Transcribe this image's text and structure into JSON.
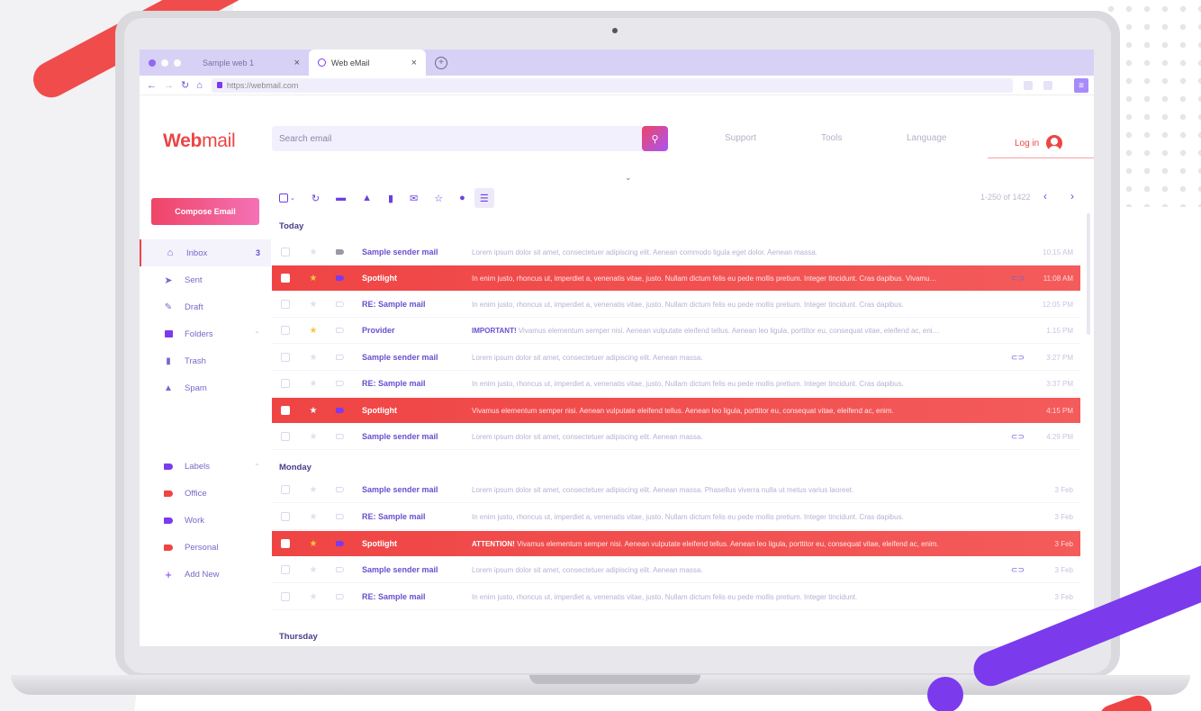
{
  "browser": {
    "tabs": [
      {
        "label": "Sample web 1",
        "active": false
      },
      {
        "label": "Web eMail",
        "active": true
      }
    ],
    "url": "https://webmail.com"
  },
  "app": {
    "logo_bold": "Web",
    "logo_light": "mail",
    "search_placeholder": "Search email",
    "nav": [
      "Support",
      "Tools",
      "Language"
    ],
    "login_label": "Log in"
  },
  "sidebar": {
    "compose_label": "Compose Email",
    "items": [
      {
        "label": "Inbox",
        "count": "3",
        "icon": "inbox-icon"
      },
      {
        "label": "Sent",
        "icon": "send-icon"
      },
      {
        "label": "Draft",
        "icon": "pencil-icon"
      },
      {
        "label": "Folders",
        "icon": "folder-icon"
      },
      {
        "label": "Trash",
        "icon": "trash-icon"
      },
      {
        "label": "Spam",
        "icon": "spam-icon"
      }
    ],
    "labels_title": "Labels",
    "labels": [
      {
        "label": "Office",
        "color": "#ef4444"
      },
      {
        "label": "Work",
        "color": "#7c3aed"
      },
      {
        "label": "Personal",
        "color": "#ef4444"
      }
    ],
    "add_new": "Add New"
  },
  "toolbar": {
    "pager": "1-250 of 1422"
  },
  "sections": {
    "today": "Today",
    "monday": "Monday",
    "thursday": "Thursday"
  },
  "emails": [
    {
      "sender": "Sample sender mail",
      "lead": "",
      "preview": "Lorem ipsum dolor sit amet, consectetuer adipiscing elit. Aenean commodo ligula eget dolor. Aenean massa.",
      "time": "10:15 AM",
      "starred": false,
      "highlight": false,
      "tag": "gray",
      "attachment": false
    },
    {
      "sender": "Spotlight",
      "lead": "",
      "preview": "In enim justo, rhoncus ut, imperdiet a, venenatis vitae, justo. Nullam dictum felis eu pede mollis pretium. Integer tincidunt. Cras dapibus. Vivamus elementum.",
      "time": "11:08 AM",
      "starred": true,
      "highlight": true,
      "tag": "purple",
      "attachment": true
    },
    {
      "sender": "RE: Sample mail",
      "lead": "",
      "preview": "In enim justo, rhoncus ut, imperdiet a, venenatis vitae, justo. Nullam dictum felis eu pede mollis pretium. Integer tincidunt. Cras dapibus.",
      "time": "12:05 PM",
      "starred": false,
      "highlight": false,
      "tag": "outline",
      "attachment": false
    },
    {
      "sender": "Provider",
      "lead": "IMPORTANT!",
      "preview": "Vivamus elementum semper nisi. Aenean vulputate eleifend tellus. Aenean leo ligula, porttitor eu, consequat vitae, eleifend ac, enim.",
      "time": "1:15 PM",
      "starred": true,
      "highlight": false,
      "tag": "outline",
      "attachment": false
    },
    {
      "sender": "Sample sender mail",
      "lead": "",
      "preview": "Lorem ipsum dolor sit amet, consectetuer adipiscing elit. Aenean massa.",
      "time": "3:27 PM",
      "starred": false,
      "highlight": false,
      "tag": "outline",
      "attachment": true
    },
    {
      "sender": "RE: Sample mail",
      "lead": "",
      "preview": "In enim justo, rhoncus ut, imperdiet a, venenatis vitae, justo. Nullam dictum felis eu pede mollis pretium. Integer tincidunt. Cras dapibus.",
      "time": "3:37 PM",
      "starred": false,
      "highlight": false,
      "tag": "outline",
      "attachment": false
    },
    {
      "sender": "Spotlight",
      "lead": "",
      "preview": "Vivamus elementum semper nisi. Aenean vulputate eleifend tellus. Aenean leo ligula, porttitor eu, consequat vitae, eleifend ac, enim.",
      "time": "4:15 PM",
      "starred": true,
      "highlight": true,
      "tag": "purple",
      "attachment": false
    },
    {
      "sender": "Sample sender mail",
      "lead": "",
      "preview": "Lorem ipsum dolor sit amet, consectetuer adipiscing elit. Aenean massa.",
      "time": "4:29 PM",
      "starred": false,
      "highlight": false,
      "tag": "outline",
      "attachment": true
    },
    {
      "sender": "Sample sender mail",
      "lead": "",
      "preview": "Lorem ipsum dolor sit amet, consectetuer adipiscing elit. Aenean massa. Phasellus viverra nulla ut metus varius laoreet.",
      "time": "3 Feb",
      "starred": false,
      "highlight": false,
      "tag": "outline",
      "attachment": false
    },
    {
      "sender": "RE: Sample mail",
      "lead": "",
      "preview": "In enim justo, rhoncus ut, imperdiet a, venenatis vitae, justo. Nullam dictum felis eu pede mollis pretium. Integer tincidunt. Cras dapibus.",
      "time": "3 Feb",
      "starred": false,
      "highlight": false,
      "tag": "outline",
      "attachment": false
    },
    {
      "sender": "Spotlight",
      "lead": "ATTENTION!",
      "preview": "Vivamus elementum semper nisi. Aenean vulputate eleifend tellus. Aenean leo ligula, porttitor eu, consequat vitae, eleifend ac, enim.",
      "time": "3 Feb",
      "starred": true,
      "highlight": true,
      "tag": "purple",
      "attachment": false
    },
    {
      "sender": "Sample sender mail",
      "lead": "",
      "preview": "Lorem ipsum dolor sit amet, consectetuer adipiscing elit. Aenean massa.",
      "time": "3 Feb",
      "starred": false,
      "highlight": false,
      "tag": "outline",
      "attachment": true
    },
    {
      "sender": "RE: Sample mail",
      "lead": "",
      "preview": "In enim justo, rhoncus ut, imperdiet a, venenatis vitae, justo. Nullam dictum felis eu pede mollis pretium. Integer tincidunt.",
      "time": "3 Feb",
      "starred": false,
      "highlight": false,
      "tag": "outline",
      "attachment": false
    }
  ],
  "colors": {
    "accent": "#ef4444",
    "highlight_row": "#f45b5b",
    "brand_purple": "#7c3aed"
  }
}
